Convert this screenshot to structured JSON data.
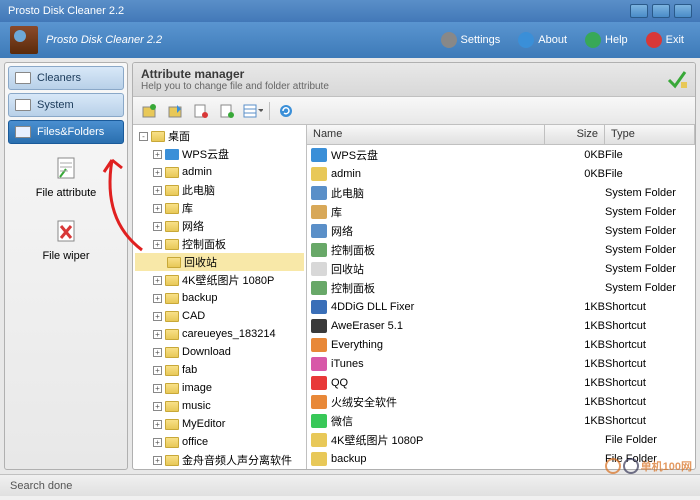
{
  "window": {
    "title": "Prosto Disk Cleaner 2.2"
  },
  "header": {
    "app_title": "Prosto Disk Cleaner 2.2",
    "settings": "Settings",
    "about": "About",
    "help": "Help",
    "exit": "Exit"
  },
  "sidebar": {
    "cleaners": "Cleaners",
    "system": "System",
    "files_folders": "Files&Folders",
    "file_attribute": "File attribute",
    "file_wiper": "File wiper"
  },
  "content": {
    "title": "Attribute manager",
    "subtitle": "Help you to change file and folder attribute"
  },
  "tree": [
    {
      "label": "桌面",
      "root": true,
      "expand": "-"
    },
    {
      "label": "WPS云盘",
      "expand": "+",
      "icon": "#3a8fd8"
    },
    {
      "label": "admin",
      "expand": "+"
    },
    {
      "label": "此电脑",
      "expand": "+"
    },
    {
      "label": "库",
      "expand": "+"
    },
    {
      "label": "网络",
      "expand": "+"
    },
    {
      "label": "控制面板",
      "expand": "+"
    },
    {
      "label": "回收站",
      "expand": "",
      "selected": true
    },
    {
      "label": "4K壁纸图片 1080P",
      "expand": "+"
    },
    {
      "label": "backup",
      "expand": "+"
    },
    {
      "label": "CAD",
      "expand": "+"
    },
    {
      "label": "careueyes_183214",
      "expand": "+"
    },
    {
      "label": "Download",
      "expand": "+"
    },
    {
      "label": "fab",
      "expand": "+"
    },
    {
      "label": "image",
      "expand": "+"
    },
    {
      "label": "music",
      "expand": "+"
    },
    {
      "label": "MyEditor",
      "expand": "+"
    },
    {
      "label": "office",
      "expand": "+"
    },
    {
      "label": "金舟音频人声分离软件",
      "expand": "+"
    }
  ],
  "list_headers": {
    "name": "Name",
    "size": "Size",
    "type": "Type"
  },
  "list": [
    {
      "name": "WPS云盘",
      "size": "0KB",
      "type": "File",
      "icon": "#3a8fd8"
    },
    {
      "name": "admin",
      "size": "0KB",
      "type": "File",
      "icon": "#e8c858"
    },
    {
      "name": "此电脑",
      "size": "",
      "type": "System Folder",
      "icon": "#5a8fc8"
    },
    {
      "name": "库",
      "size": "",
      "type": "System Folder",
      "icon": "#d8a858"
    },
    {
      "name": "网络",
      "size": "",
      "type": "System Folder",
      "icon": "#5a8fc8"
    },
    {
      "name": "控制面板",
      "size": "",
      "type": "System Folder",
      "icon": "#68a868"
    },
    {
      "name": "回收站",
      "size": "",
      "type": "System Folder",
      "icon": "#d8d8d8"
    },
    {
      "name": "控制面板",
      "size": "",
      "type": "System Folder",
      "icon": "#68a868"
    },
    {
      "name": "4DDiG DLL Fixer",
      "size": "1KB",
      "type": "Shortcut",
      "icon": "#3a6fb8"
    },
    {
      "name": "AweEraser 5.1",
      "size": "1KB",
      "type": "Shortcut",
      "icon": "#3a3a3a"
    },
    {
      "name": "Everything",
      "size": "1KB",
      "type": "Shortcut",
      "icon": "#e88838"
    },
    {
      "name": "iTunes",
      "size": "1KB",
      "type": "Shortcut",
      "icon": "#d858a8"
    },
    {
      "name": "QQ",
      "size": "1KB",
      "type": "Shortcut",
      "icon": "#e83838"
    },
    {
      "name": "火绒安全软件",
      "size": "1KB",
      "type": "Shortcut",
      "icon": "#e88838"
    },
    {
      "name": "微信",
      "size": "1KB",
      "type": "Shortcut",
      "icon": "#38c858"
    },
    {
      "name": "4K壁纸图片 1080P",
      "size": "",
      "type": "File Folder",
      "icon": "#e8c858"
    },
    {
      "name": "backup",
      "size": "",
      "type": "File Folder",
      "icon": "#e8c858"
    }
  ],
  "statusbar": {
    "text": "Search done"
  },
  "watermark": "单机100网"
}
